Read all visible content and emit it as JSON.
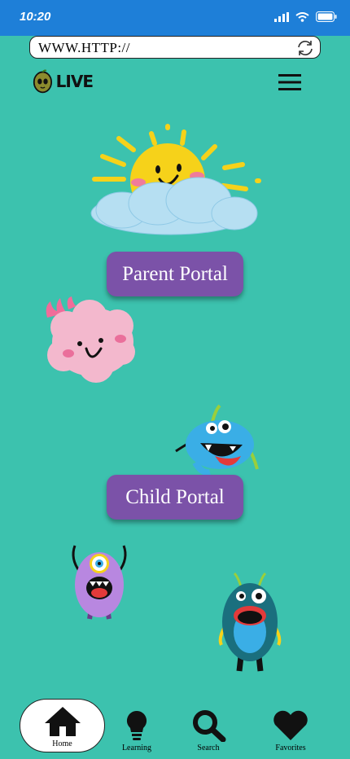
{
  "status": {
    "time": "10:20"
  },
  "browser": {
    "url": "WWW.HTTP://"
  },
  "header": {
    "logo_text": "LIVE"
  },
  "main": {
    "parent_portal_label": "Parent Portal",
    "child_portal_label": "Child Portal"
  },
  "tabs": [
    {
      "label": "Home",
      "icon": "home-icon",
      "active": true
    },
    {
      "label": "Learning",
      "icon": "lightbulb-icon",
      "active": false
    },
    {
      "label": "Search",
      "icon": "search-icon",
      "active": false
    },
    {
      "label": "Favorites",
      "icon": "heart-icon",
      "active": false
    }
  ],
  "colors": {
    "background": "#3cc2ae",
    "status_bar": "#1e7fd8",
    "portal_button": "#7b52a8"
  }
}
